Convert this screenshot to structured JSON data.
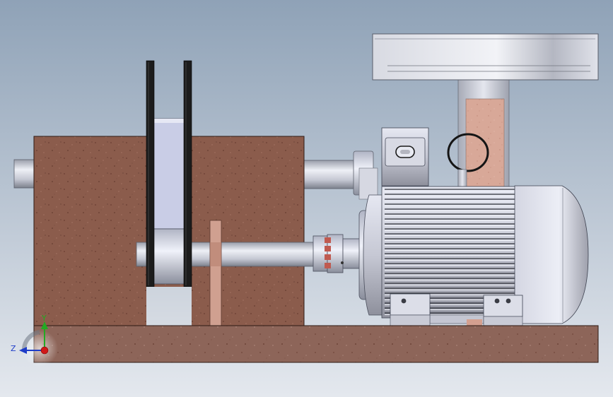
{
  "viewport": {
    "background_top": "#8fa2b7",
    "background_bottom": "#e4e8ee"
  },
  "materials": {
    "cast_stone": "#8a5a4a",
    "steel": "#c8cbd8",
    "steel_dark": "#6d7180",
    "belt": "#1c1c1c",
    "coupling_insert": "#c05a50",
    "base": "#8a6458"
  },
  "triad": {
    "y_label": "Y",
    "z_label": "Z",
    "y_color": "#22aa22",
    "z_color": "#1e3cc8",
    "x_color": "#d01818"
  }
}
